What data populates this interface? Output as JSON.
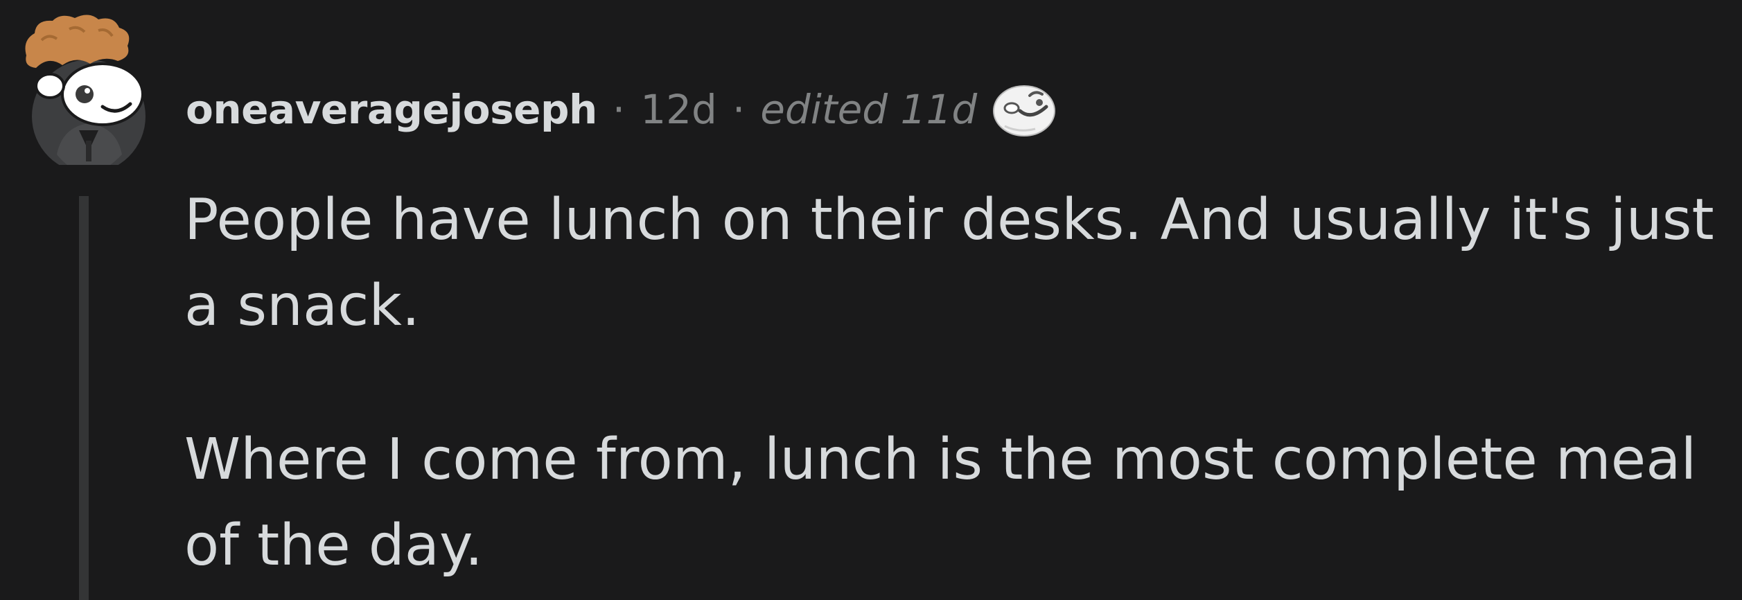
{
  "comment": {
    "username": "oneaveragejoseph",
    "separator": "·",
    "age": "12d",
    "edited": "edited 11d",
    "avatar_icon": "snoo-avatar-icon",
    "award_icon": "award-icon",
    "paragraphs": [
      "People have lunch on their desks. And usually it's just a snack.",
      "Where I come from, lunch is the most complete meal of the day."
    ]
  },
  "colors": {
    "background": "#1a1a1b",
    "text": "#d7dadc",
    "meta": "#818384",
    "thread_line": "#343536",
    "avatar_hair": "#c8864a"
  }
}
